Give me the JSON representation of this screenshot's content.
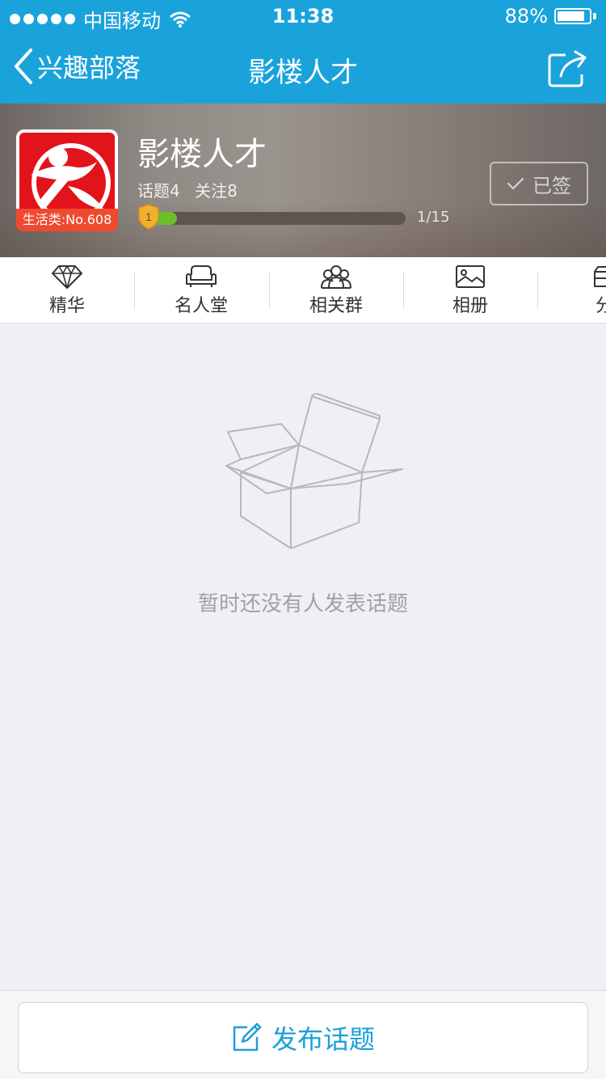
{
  "status_bar": {
    "carrier": "中国移动",
    "time": "11:38",
    "battery_percent": "88%",
    "battery_level": 0.88
  },
  "nav": {
    "back_label": "兴趣部落",
    "title": "影楼人才",
    "share_icon": "share-icon"
  },
  "tribe": {
    "name": "影楼人才",
    "rank_badge": "生活类:No.608",
    "stats": {
      "topics": "话题4",
      "followers": "关注8"
    },
    "level": "1",
    "progress_text": "1/15",
    "progress_fraction": 0.0667,
    "signed_label": "已签"
  },
  "tabs": [
    {
      "label": "精华",
      "icon": "diamond-icon"
    },
    {
      "label": "名人堂",
      "icon": "sofa-icon"
    },
    {
      "label": "相关群",
      "icon": "group-icon"
    },
    {
      "label": "相册",
      "icon": "photo-icon"
    },
    {
      "label": "分",
      "icon": "category-icon"
    }
  ],
  "empty_state": {
    "message": "暂时还没有人发表话题",
    "icon": "open-box-icon"
  },
  "bottom": {
    "publish_label": "发布话题",
    "publish_icon": "edit-icon"
  },
  "colors": {
    "primary": "#1aa3db",
    "badge": "#ef4a2f",
    "logo_bg": "#e3131b",
    "progress": "#6bbf2c"
  }
}
